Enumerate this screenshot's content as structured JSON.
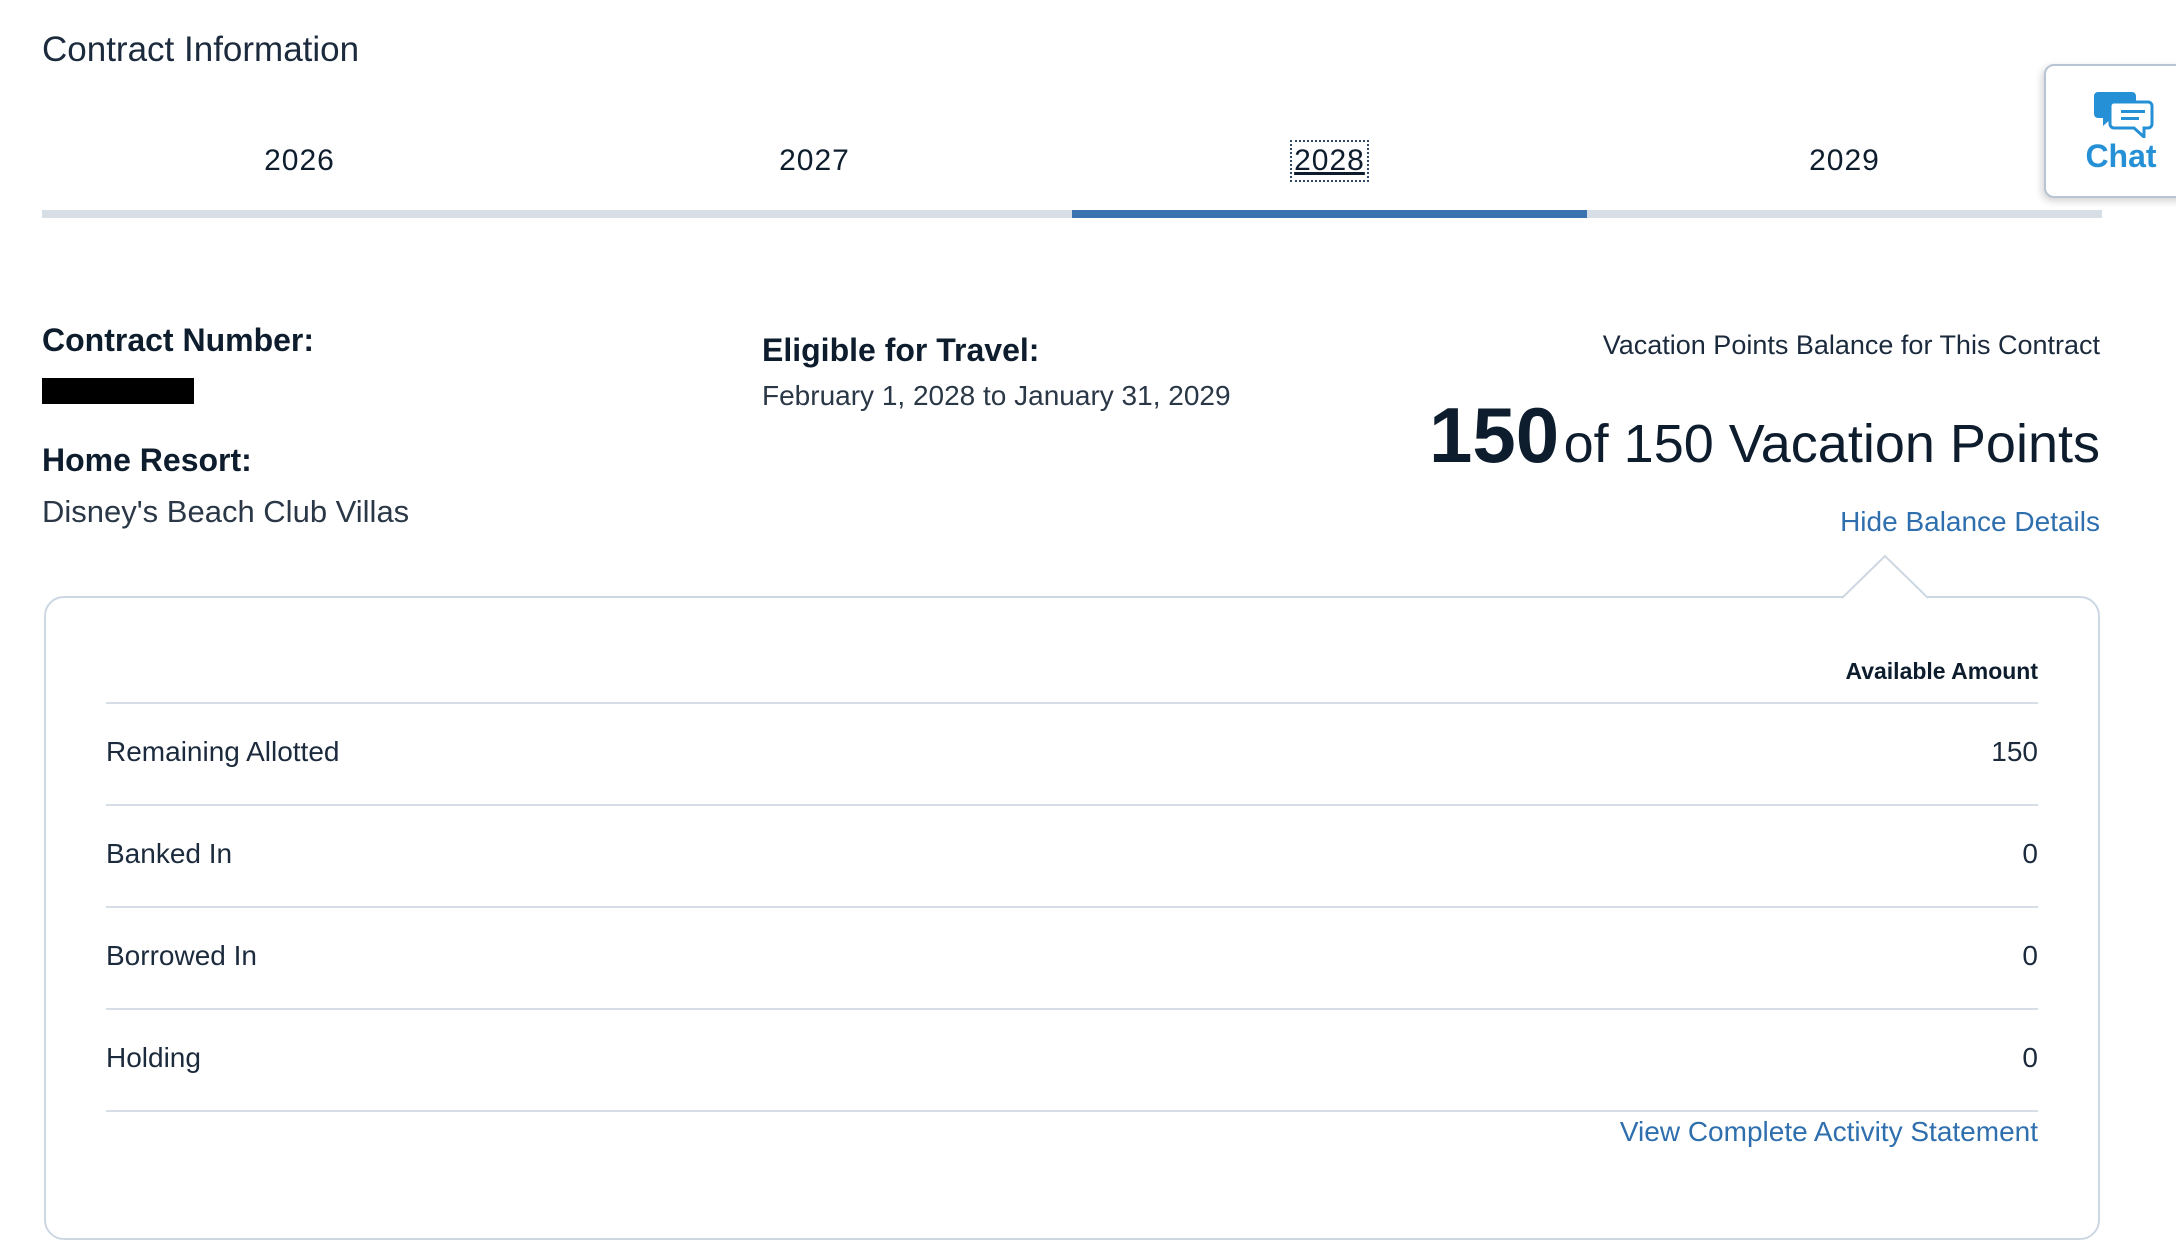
{
  "page": {
    "title": "Contract Information"
  },
  "tabs": [
    {
      "label": "2026",
      "active": false
    },
    {
      "label": "2027",
      "active": false
    },
    {
      "label": "2028",
      "active": true
    },
    {
      "label": "2029",
      "active": false
    }
  ],
  "chat": {
    "label": "Chat",
    "icon": "chat-bubbles-icon",
    "color": "#2690d6"
  },
  "contract": {
    "number_label": "Contract Number:",
    "home_resort_label": "Home Resort:",
    "home_resort_value": "Disney's Beach Club Villas",
    "eligible_label": "Eligible for Travel:",
    "eligible_value": "February 1, 2028 to January 31, 2029"
  },
  "balance": {
    "title": "Vacation Points Balance for This Contract",
    "current": "150",
    "rest": "of 150 Vacation Points",
    "hide_details_label": "Hide Balance Details"
  },
  "details": {
    "column_header": "Available Amount",
    "rows": [
      {
        "label": "Remaining Allotted",
        "value": "150"
      },
      {
        "label": "Banked In",
        "value": "0"
      },
      {
        "label": "Borrowed In",
        "value": "0"
      },
      {
        "label": "Holding",
        "value": "0"
      }
    ],
    "activity_link_label": "View Complete Activity Statement"
  },
  "colors": {
    "accent": "#3a73b0",
    "link": "#2f6fae",
    "tab_track": "#d8dee6"
  }
}
